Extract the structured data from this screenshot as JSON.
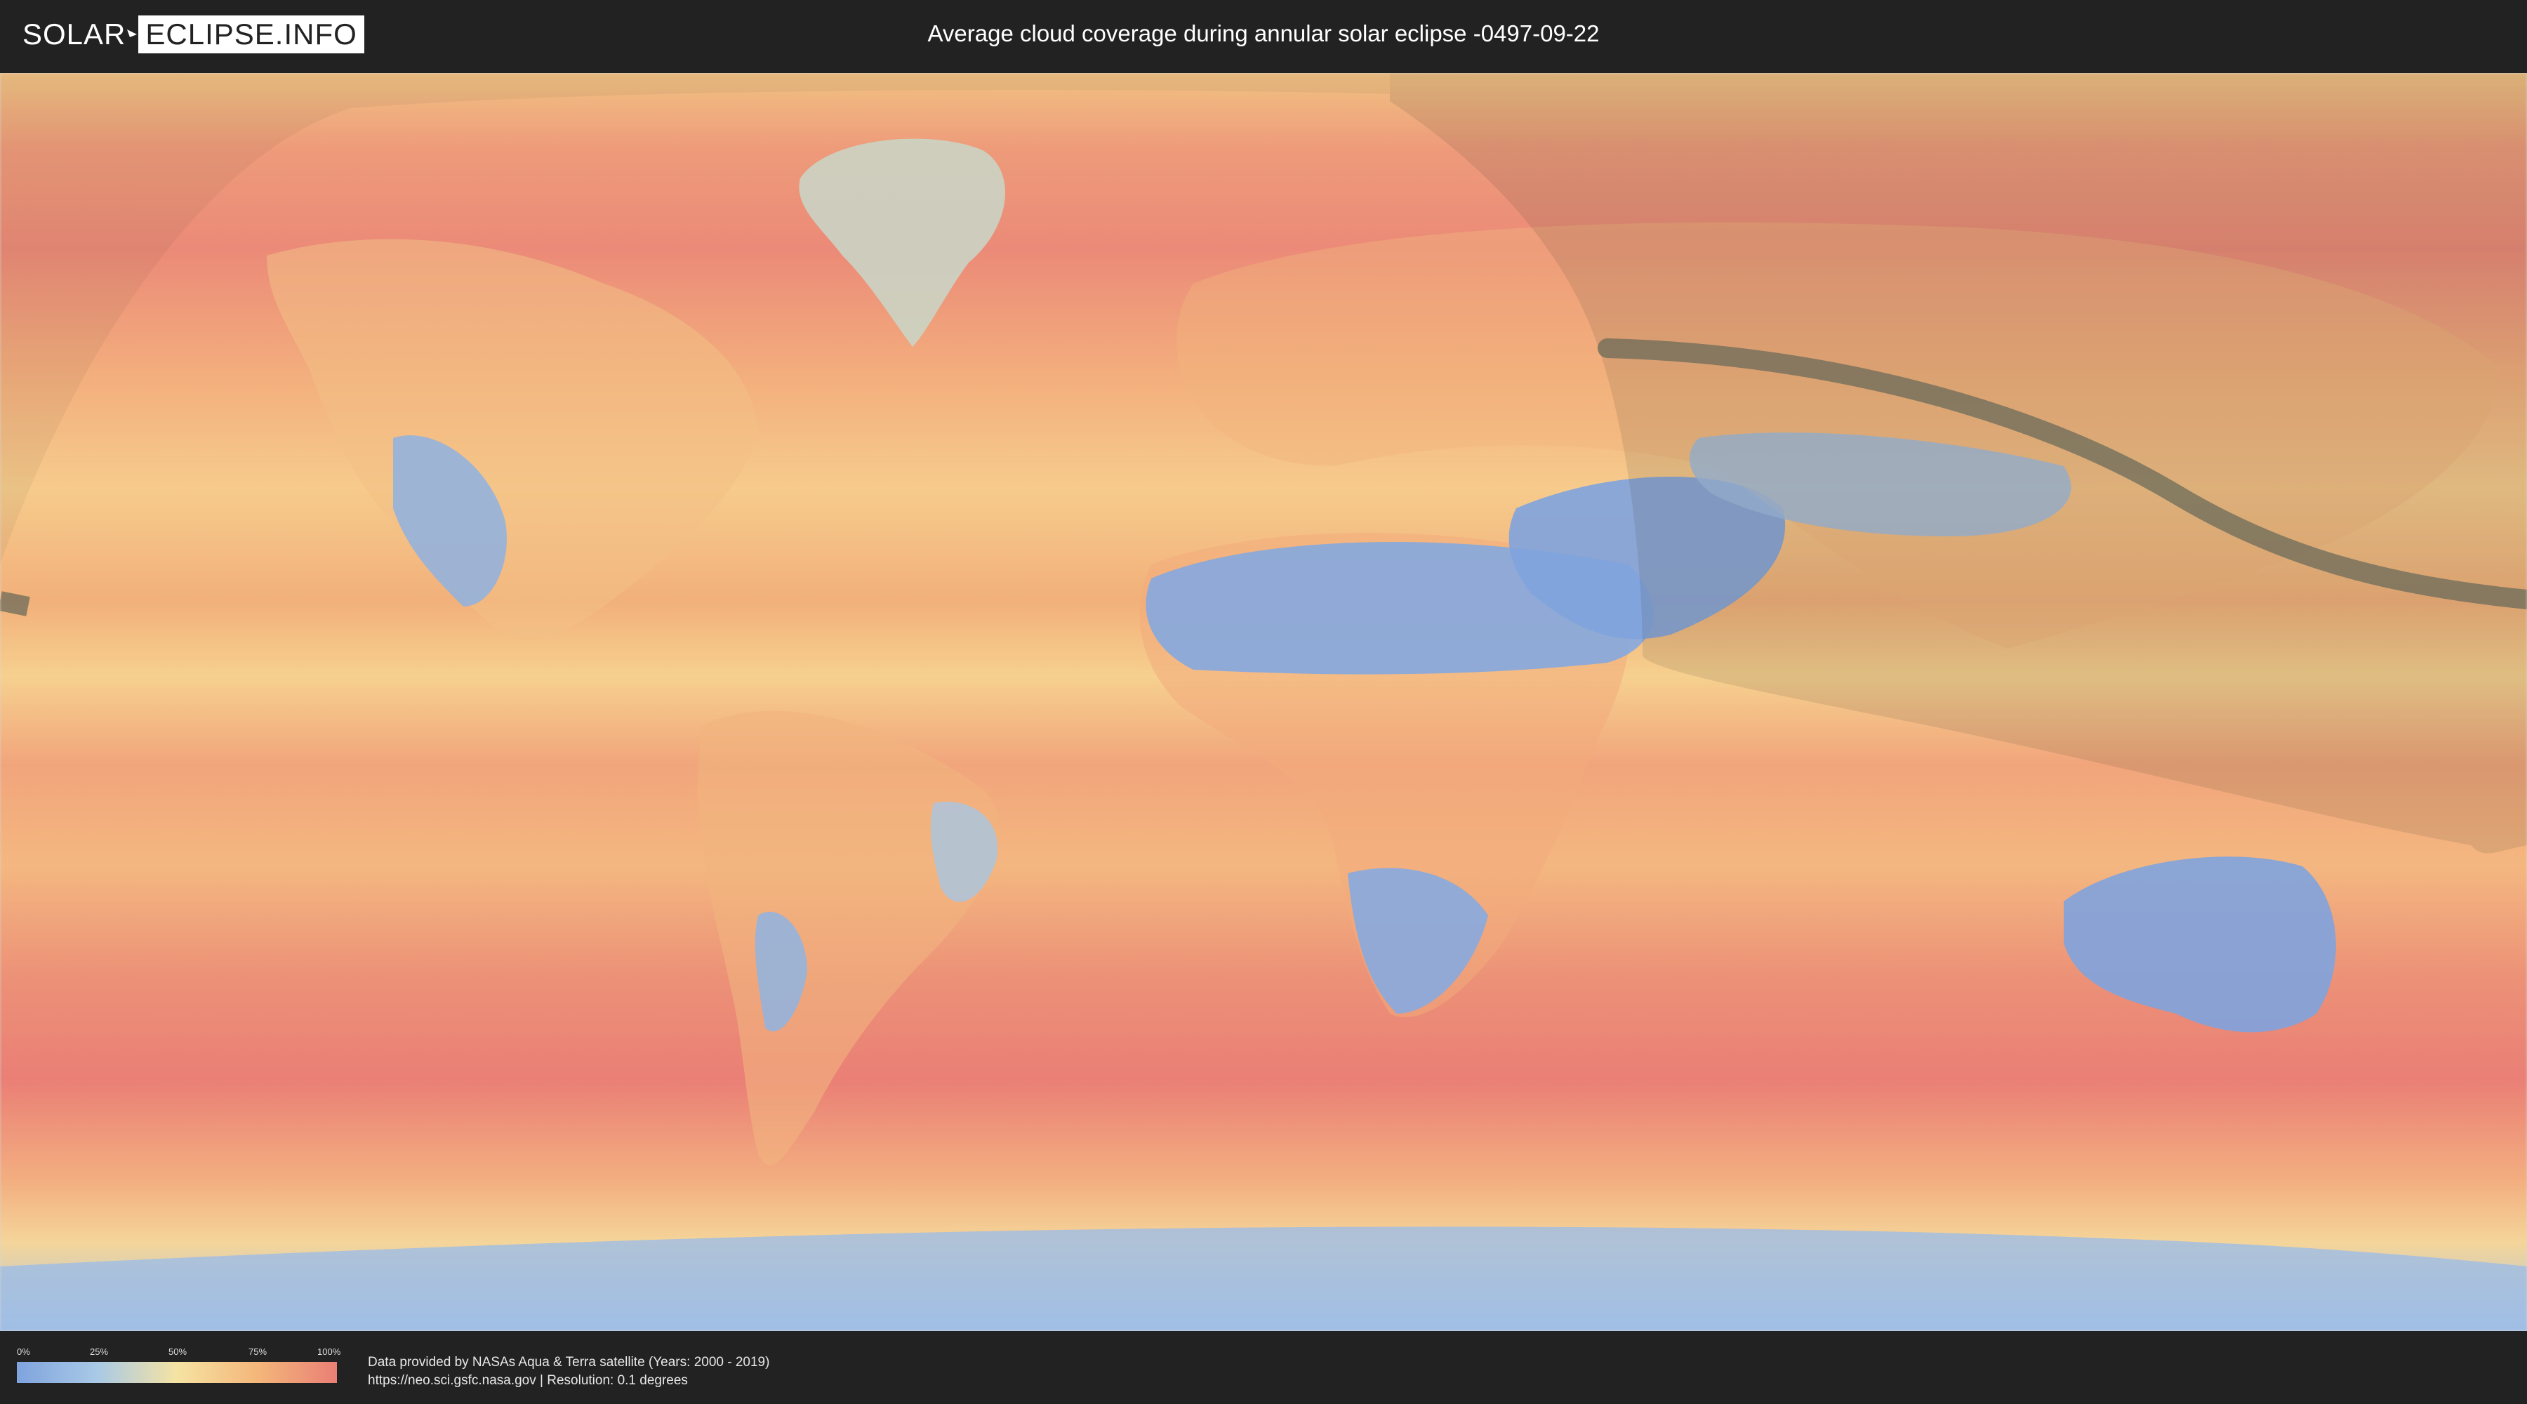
{
  "header": {
    "logo_left": "SOLAR",
    "logo_right": "ECLIPSE.INFO",
    "title": "Average cloud coverage during annular solar eclipse -0497-09-22"
  },
  "map": {
    "description_colors": {
      "clear": "#7fa3de",
      "low": "#a9c9e6",
      "mid": "#f5e3a3",
      "high": "#f4b77a",
      "overcast": "#ea7f76"
    },
    "eclipse_path_color": "#6b6b5a",
    "night_shade_color": "#3a3a2a"
  },
  "legend": {
    "ticks": [
      "0%",
      "25%",
      "50%",
      "75%",
      "100%"
    ]
  },
  "credits": {
    "line1": "Data provided by NASAs Aqua & Terra satellite (Years: 2000 - 2019)",
    "line2": "https://neo.sci.gsfc.nasa.gov | Resolution: 0.1 degrees"
  }
}
